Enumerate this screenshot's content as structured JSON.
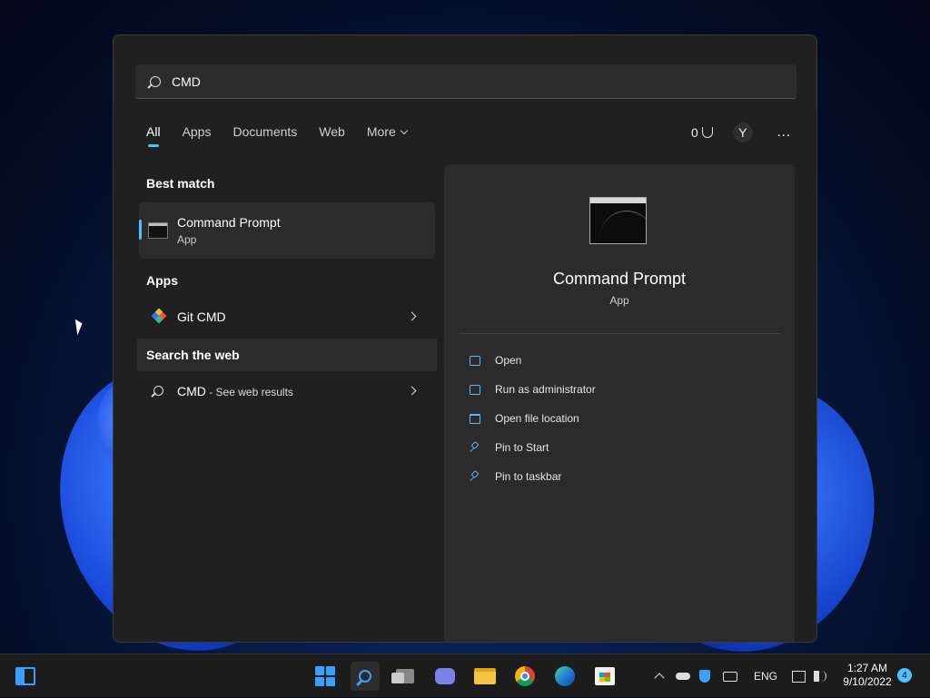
{
  "search": {
    "query": "CMD"
  },
  "tabs": [
    "All",
    "Apps",
    "Documents",
    "Web",
    "More"
  ],
  "header": {
    "points": "0",
    "avatar": "Y",
    "more_options": "…"
  },
  "best_match": {
    "heading": "Best match",
    "name": "Command Prompt",
    "type": "App"
  },
  "apps": {
    "heading": "Apps",
    "items": [
      {
        "name": "Git CMD"
      }
    ]
  },
  "web": {
    "heading": "Search the web",
    "query": "CMD",
    "suffix": " - See web results"
  },
  "detail": {
    "title": "Command Prompt",
    "subtitle": "App",
    "actions": [
      "Open",
      "Run as administrator",
      "Open file location",
      "Pin to Start",
      "Pin to taskbar"
    ]
  },
  "tray": {
    "language": "ENG",
    "time": "1:27 AM",
    "date": "9/10/2022",
    "notifications": "4"
  },
  "colors": {
    "accent": "#4cc2ff",
    "panel": "#202020",
    "detail": "#2b2b2b",
    "taskbar": "#1c1c1c"
  }
}
